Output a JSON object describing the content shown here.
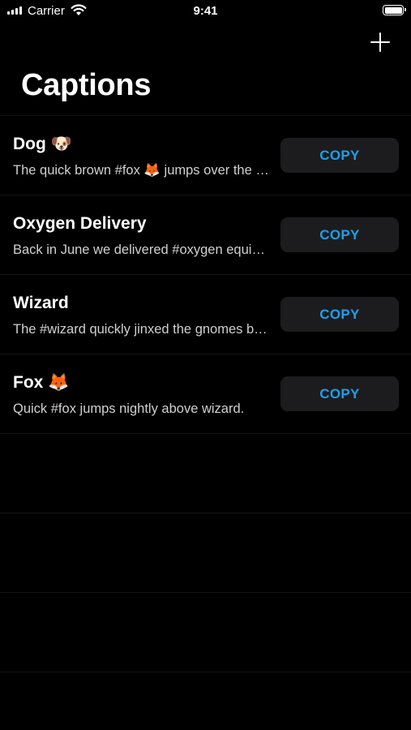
{
  "status_bar": {
    "carrier": "Carrier",
    "time": "9:41",
    "icons": [
      "cellular-signal-icon",
      "wifi-icon",
      "battery-icon"
    ]
  },
  "nav": {
    "title": "Captions",
    "add_icon": "plus-icon"
  },
  "captions": [
    {
      "title": "Dog 🐶",
      "text": "The quick brown #fox 🦊 jumps over the lazy #dog 🐶",
      "button": "COPY"
    },
    {
      "title": "Oxygen Delivery",
      "text": "Back in June we delivered #oxygen equipment of the same size",
      "button": "COPY"
    },
    {
      "title": "Wizard",
      "text": "The #wizard quickly jinxed the gnomes before they vaporized",
      "button": "COPY"
    },
    {
      "title": "Fox 🦊",
      "text": "Quick #fox jumps nightly above wizard.",
      "button": "COPY"
    }
  ],
  "colors": {
    "background": "#000000",
    "button_background": "#1c1c1e",
    "accent": "#1aa1ef"
  }
}
